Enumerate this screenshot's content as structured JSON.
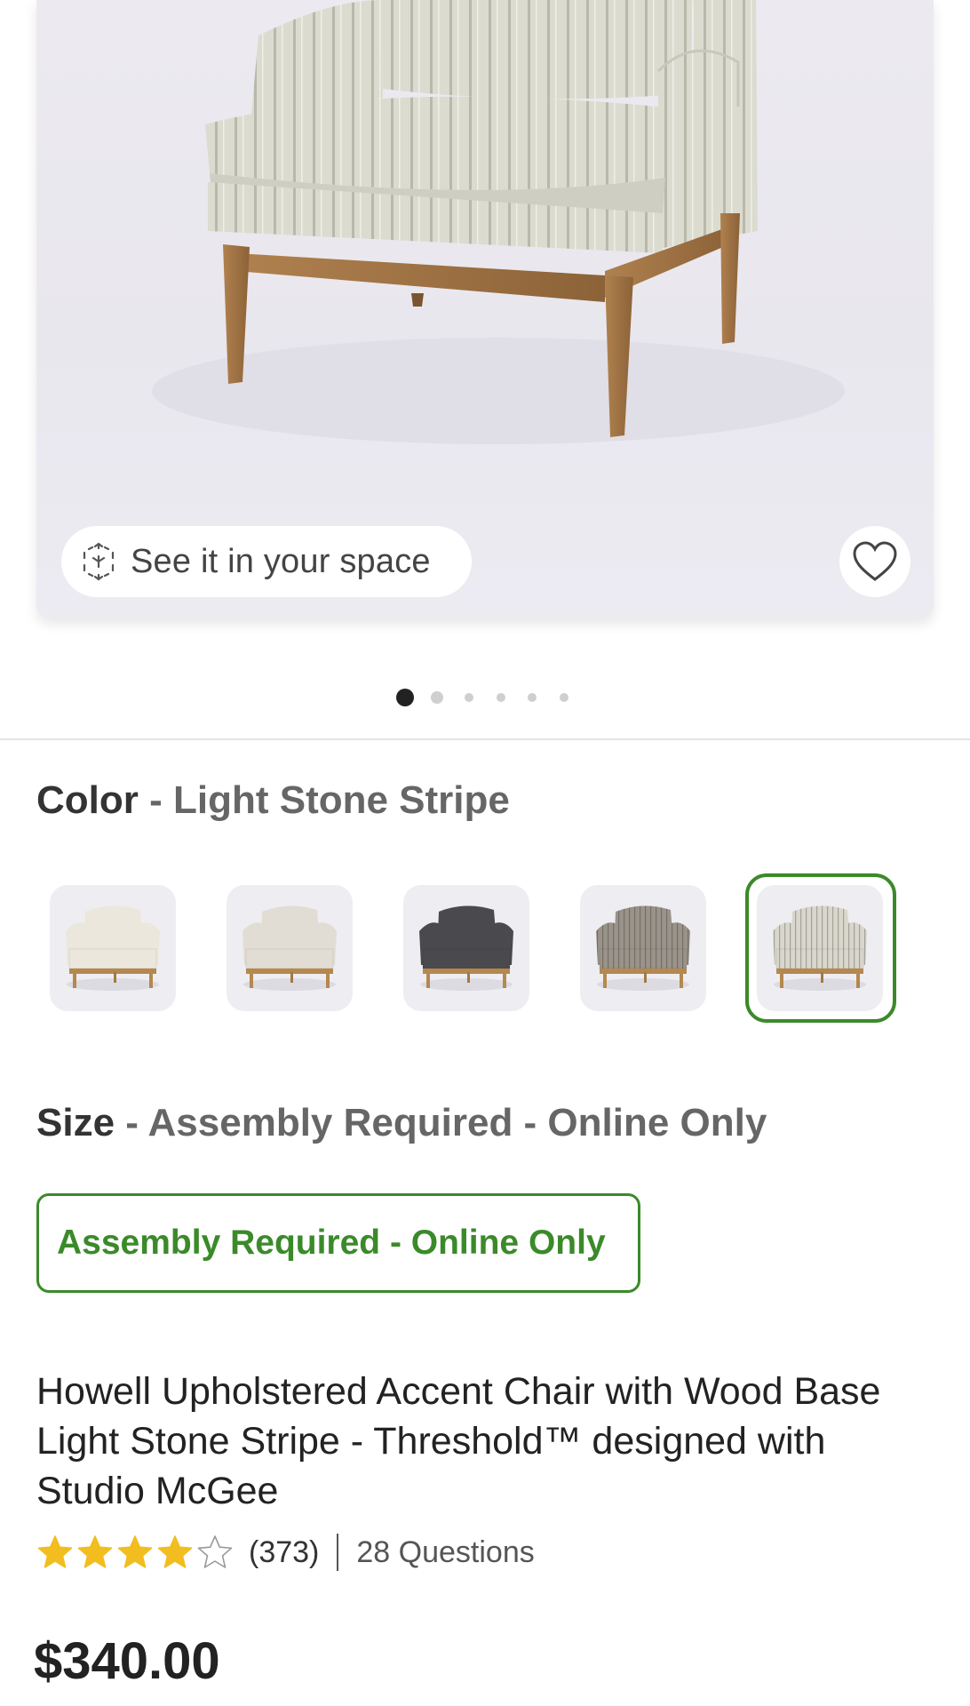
{
  "hero": {
    "ar_button_label": "See it in your space",
    "ar_icon": "ar-cube-icon",
    "favorite_icon": "heart-outline-icon",
    "carousel_total": 6,
    "carousel_active_index": 0
  },
  "color_option": {
    "label": "Color",
    "separator": " - ",
    "selected_value": "Light Stone Stripe",
    "swatches": [
      {
        "name": "cream",
        "fabric": "#ece7dc"
      },
      {
        "name": "light-gray",
        "fabric": "#e2ddd4"
      },
      {
        "name": "charcoal",
        "fabric": "#4a4a4e"
      },
      {
        "name": "brown-stripe",
        "fabric": "#9a938a"
      },
      {
        "name": "light-stone-stripe",
        "fabric": "#d9d7cc"
      }
    ],
    "selected_index": 4
  },
  "size_option": {
    "label": "Size",
    "separator": " - ",
    "selected_value": "Assembly Required - Online Only",
    "button_label": "Assembly Required - Online Only"
  },
  "product": {
    "title": "Howell Upholstered Accent Chair with Wood Base Light Stone Stripe - Threshold™ designed with Studio McGee",
    "rating_value": 4,
    "rating_max": 5,
    "review_count": "(373)",
    "questions": "28 Questions",
    "price": "$340.00"
  },
  "colors": {
    "accent_green": "#3b8a2a",
    "star_gold": "#f2bd1e",
    "dot_active": "#222222",
    "dot_inactive": "#cfcfcf"
  }
}
